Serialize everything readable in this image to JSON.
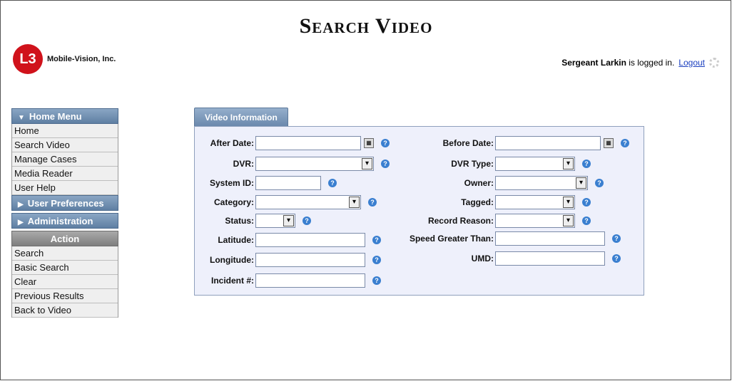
{
  "page": {
    "title": "Search Video"
  },
  "brand": {
    "logo_mark": "L3",
    "name": "Mobile-Vision, Inc."
  },
  "session": {
    "user": "Sergeant Larkin",
    "status_text": "is logged in.",
    "logout_label": "Logout"
  },
  "sidebar": {
    "home_menu": {
      "title": "Home Menu",
      "items": [
        "Home",
        "Search Video",
        "Manage Cases",
        "Media Reader",
        "User Help"
      ]
    },
    "user_preferences": {
      "title": "User Preferences"
    },
    "administration": {
      "title": "Administration"
    },
    "action": {
      "title": "Action",
      "items": [
        "Search",
        "Basic Search",
        "Clear",
        "Previous Results",
        "Back to Video"
      ]
    }
  },
  "form": {
    "tab_label": "Video Information",
    "left_fields": {
      "after_date": "After Date:",
      "dvr": "DVR:",
      "system_id": "System ID:",
      "category": "Category:",
      "status": "Status:",
      "latitude": "Latitude:",
      "longitude": "Longitude:",
      "incident": "Incident #:"
    },
    "right_fields": {
      "before_date": "Before Date:",
      "dvr_type": "DVR Type:",
      "owner": "Owner:",
      "tagged": "Tagged:",
      "record_reason": "Record Reason:",
      "speed_greater_than": "Speed Greater Than:",
      "umd": "UMD:"
    },
    "help_glyph": "?",
    "dropdown_glyph": "▾"
  },
  "icons": {
    "calendar": "calendar-icon",
    "help": "help-icon",
    "dropdown": "chevron-down-icon"
  },
  "colors": {
    "menu_header": "#6b89ad",
    "action_header": "#8f8f8f",
    "panel_bg": "#eef0fb",
    "help": "#3a7fd0",
    "logo": "#d0121b"
  }
}
